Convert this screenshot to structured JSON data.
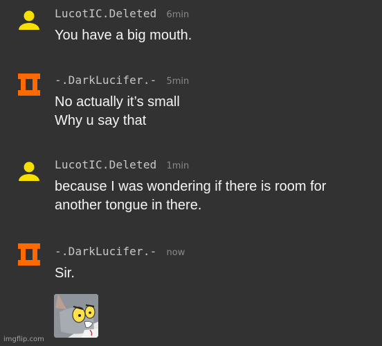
{
  "messages": [
    {
      "username": "LucotIC.Deleted",
      "time": "6min",
      "avatar": "yellow-person-icon",
      "lines": [
        "You have a big mouth."
      ]
    },
    {
      "username": "-.DarkLucifer.-",
      "time": "5min",
      "avatar": "orange-block-icon",
      "lines": [
        "No actually it’s small",
        "Why u say that"
      ]
    },
    {
      "username": "LucotIC.Deleted",
      "time": "1min",
      "avatar": "yellow-person-icon",
      "lines": [
        "because I was wondering if there is room for",
        "another tongue in there."
      ]
    },
    {
      "username": "-.DarkLucifer.-",
      "time": "now",
      "avatar": "orange-block-icon",
      "lines": [
        "Sir."
      ],
      "attachment": "shocked-cat-sticker"
    }
  ],
  "watermark": "imgflip.com",
  "colors": {
    "background": "#323232",
    "yellow_avatar": "#f5e000",
    "orange_avatar": "#ff6a00"
  }
}
